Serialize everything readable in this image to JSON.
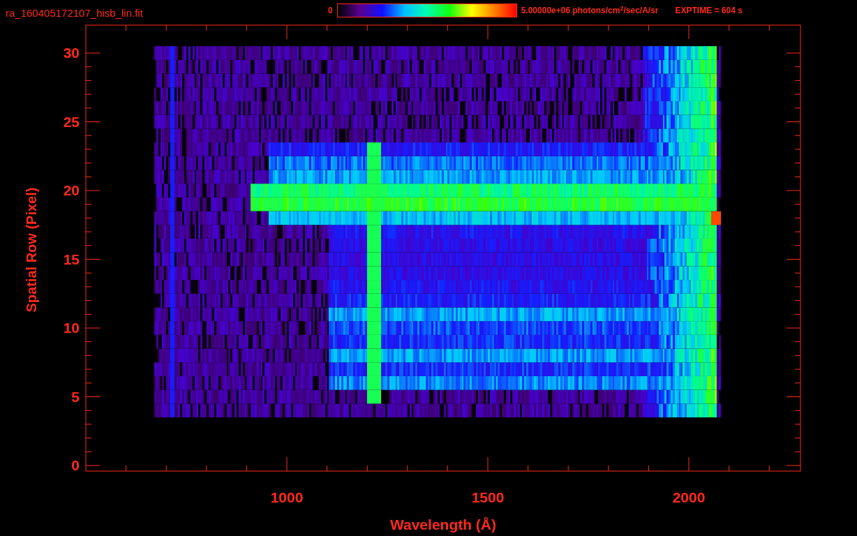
{
  "file_title": "ra_160405172107_hisb_lin.fit",
  "colorbar": {
    "min_label": "0",
    "max_label": "5.00000e+06 photons/cm$^{2}$/sec/A/sr"
  },
  "exposure": "EXPTIME = 604 s",
  "plot": {
    "ylabel": "Spatial Row (Pixel)",
    "xlabel": "Wavelength (Å)",
    "yticks": [
      "30",
      "25",
      "20",
      "15",
      "10",
      "5",
      "0"
    ],
    "xticks": [
      "1000",
      "1500",
      "2000"
    ]
  }
}
